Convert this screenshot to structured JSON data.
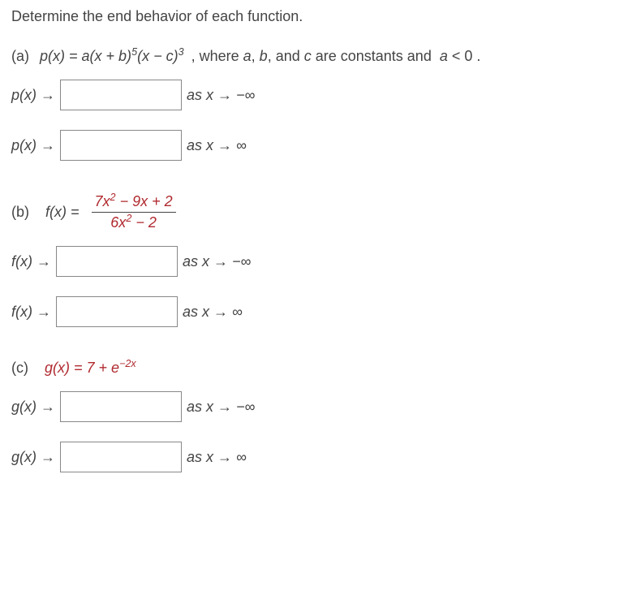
{
  "instruction": "Determine the end behavior of each function.",
  "parts": {
    "a": {
      "label": "(a)",
      "fnLeft": "p(x) = a(x + b)",
      "sup1": "5",
      "fnMid": "(x − c)",
      "sup2": "3",
      "trail": " , where a, b, and c are constants and  a < 0 .",
      "rows": [
        {
          "fn": "p(x) →",
          "limit": "as x → −∞"
        },
        {
          "fn": "p(x) →",
          "limit": "as x → ∞"
        }
      ]
    },
    "b": {
      "label": "(b)",
      "fnName": "f(x)  =",
      "num_a": "7x",
      "num_sup": "2",
      "num_b": " − 9x + 2",
      "den_a": "6x",
      "den_sup": "2",
      "den_b": " − 2",
      "rows": [
        {
          "fn": "f(x) →",
          "limit": "as x → −∞"
        },
        {
          "fn": "f(x) →",
          "limit": "as x → ∞"
        }
      ]
    },
    "c": {
      "label": "(c)",
      "fnText_a": "g(x) = 7 + e",
      "fnSup": "−2x",
      "rows": [
        {
          "fn": "g(x) →",
          "limit": "as x → −∞"
        },
        {
          "fn": "g(x) →",
          "limit": "as x → ∞"
        }
      ]
    }
  }
}
